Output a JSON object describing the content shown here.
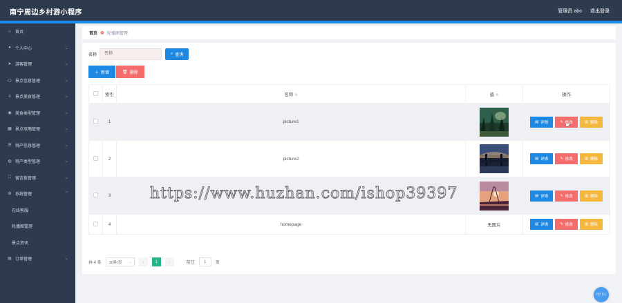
{
  "header": {
    "title": "南宁周边乡村游小程序",
    "user_label": "管理员 abo",
    "logout_label": "退出登录"
  },
  "sidebar": {
    "items": [
      {
        "label": "首页",
        "icon": "home-icon",
        "chevron": false
      },
      {
        "label": "个人中心",
        "icon": "user-icon",
        "chevron": true
      },
      {
        "label": "游客管理",
        "icon": "send-icon",
        "chevron": true
      },
      {
        "label": "景点信息管理",
        "icon": "chat-icon",
        "chevron": true
      },
      {
        "label": "景点美食管理",
        "icon": "menu-icon",
        "chevron": true
      },
      {
        "label": "美食类型管理",
        "icon": "location-icon",
        "chevron": true
      },
      {
        "label": "景点攻略管理",
        "icon": "grid-icon",
        "chevron": true
      },
      {
        "label": "特产信息管理",
        "icon": "list-icon",
        "chevron": true
      },
      {
        "label": "特产类型管理",
        "icon": "cart-icon",
        "chevron": true
      },
      {
        "label": "留言板管理",
        "icon": "frame-icon",
        "chevron": true
      },
      {
        "label": "系统管理",
        "icon": "gear-icon",
        "chevron": true,
        "expanded": true
      }
    ],
    "sub_items": [
      "在线客服",
      "轮播图管理",
      "景点资讯"
    ],
    "last_item": {
      "label": "订单管理",
      "icon": "order-icon",
      "chevron": true
    }
  },
  "breadcrumb": {
    "home": "首页",
    "current": "轮播图管理"
  },
  "search": {
    "label": "名称",
    "placeholder": "名称",
    "button": "查询"
  },
  "actions": {
    "add": "新增",
    "delete": "删除"
  },
  "table": {
    "headers": {
      "index": "索引",
      "name": "名称",
      "value": "值",
      "ops": "操作"
    },
    "rows": [
      {
        "index": "1",
        "name": "picture1",
        "image": "forest",
        "text": ""
      },
      {
        "index": "2",
        "name": "picture2",
        "image": "bridge",
        "text": ""
      },
      {
        "index": "3",
        "name": "",
        "image": "sunset",
        "text": ""
      },
      {
        "index": "4",
        "name": "homepage",
        "image": "",
        "text": "无图片"
      }
    ],
    "op_labels": {
      "detail": "详情",
      "edit": "修改",
      "delete": "删除"
    }
  },
  "pager": {
    "total": "共 4 条",
    "page_size": "10条/页",
    "current_page": "1",
    "goto_label": "前往",
    "goto_value": "1",
    "page_suffix": "页"
  },
  "watermark": "https://www.huzhan.com/ishop39397",
  "float_bubble": "02:21",
  "colors": {
    "topbar": "#2e3b4e",
    "accent": "#1e88e5",
    "danger": "#f56c6c",
    "warning": "#f5b83d",
    "pager_active": "#26b38a"
  }
}
